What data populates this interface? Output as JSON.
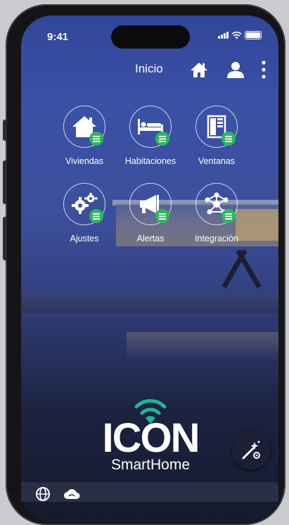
{
  "status": {
    "time": "9:41"
  },
  "header": {
    "title": "Inicio"
  },
  "tiles": [
    {
      "label": "Viviendas"
    },
    {
      "label": "Habitaciones"
    },
    {
      "label": "Ventanas"
    },
    {
      "label": "Ajustes"
    },
    {
      "label": "Alertas"
    },
    {
      "label": "Integración"
    }
  ],
  "brand": {
    "name": "ICON",
    "sub": "SmartHome"
  },
  "colors": {
    "accent": "#2cb85a",
    "wifi_mark": "#1fb59a",
    "screen_top": "#32469a"
  },
  "icons": [
    "home-icon",
    "user-icon",
    "more-vertical-icon",
    "house-icon",
    "bed-icon",
    "window-icon",
    "gears-icon",
    "megaphone-icon",
    "network-icon",
    "magic-wand-icon",
    "globe-icon",
    "cloud-icon"
  ]
}
